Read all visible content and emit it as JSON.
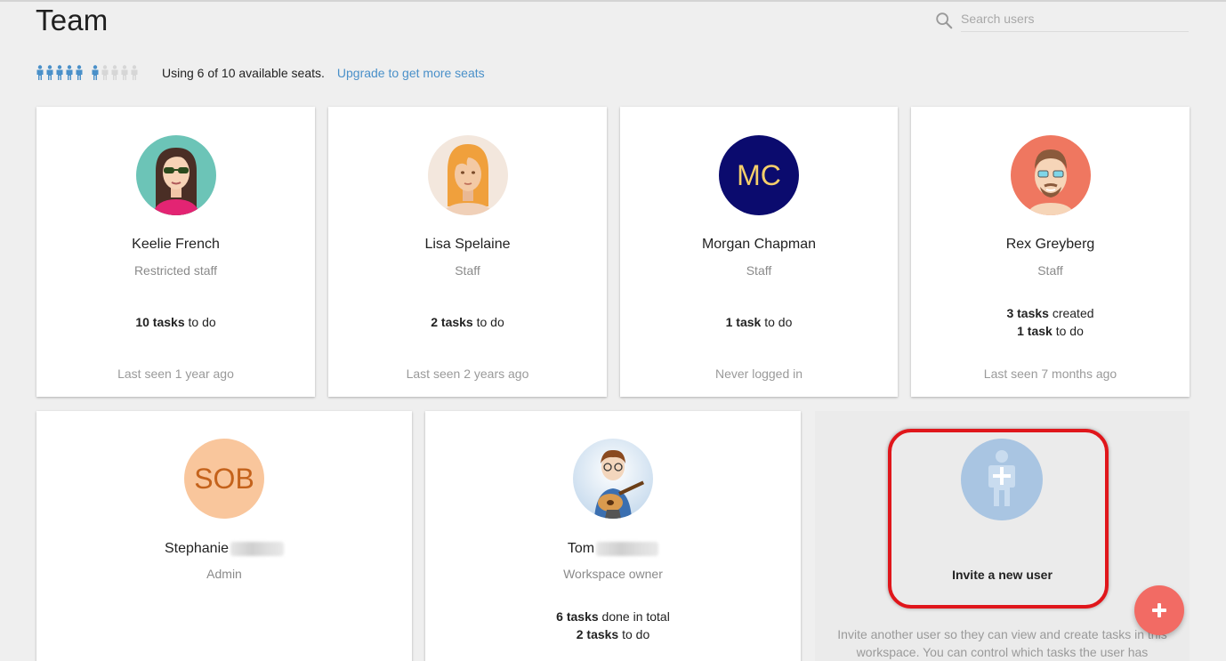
{
  "header": {
    "title": "Team",
    "search_placeholder": "Search users"
  },
  "seats": {
    "used": 6,
    "total": 10,
    "text": "Using 6 of 10 available seats.",
    "upgrade_link": "Upgrade to get more seats",
    "used_color": "#4a90c9",
    "free_color": "#d6d6d6"
  },
  "users": [
    {
      "name": "Keelie French",
      "role": "Restricted staff",
      "tasks": [
        {
          "count": "10 tasks",
          "suffix": " to do"
        }
      ],
      "last_seen": "Last seen 1 year ago",
      "avatar": "illustrated-woman-sunglasses"
    },
    {
      "name": "Lisa Spelaine",
      "role": "Staff",
      "tasks": [
        {
          "count": "2 tasks",
          "suffix": " to do"
        }
      ],
      "last_seen": "Last seen 2 years ago",
      "avatar": "illustrated-woman-blonde"
    },
    {
      "name": "Morgan Chapman",
      "role": "Staff",
      "tasks": [
        {
          "count": "1 task",
          "suffix": " to do"
        }
      ],
      "last_seen": "Never logged in",
      "avatar_initials": "MC",
      "avatar_bg": "#0b0b6e",
      "avatar_fg": "#f5cf6a"
    },
    {
      "name": "Rex Greyberg",
      "role": "Staff",
      "tasks": [
        {
          "count": "3 tasks",
          "suffix": " created"
        },
        {
          "count": "1 task",
          "suffix": " to do"
        }
      ],
      "last_seen": "Last seen 7 months ago",
      "avatar": "illustrated-man-beard"
    },
    {
      "name": "Stephanie",
      "role": "Admin",
      "avatar_initials": "SOB",
      "avatar_bg": "#f9c69c",
      "avatar_fg": "#c4621b"
    },
    {
      "name": "Tom",
      "role": "Workspace owner",
      "tasks": [
        {
          "count": "6 tasks",
          "suffix": " done in total"
        },
        {
          "count": "2 tasks",
          "suffix": " to do"
        }
      ],
      "avatar": "cartoon-guitarist"
    }
  ],
  "invite": {
    "label": "Invite a new user",
    "description": "Invite another user so they can view and create tasks in this workspace. You can control which tasks the user has",
    "highlight_color": "#e0161b"
  },
  "fab": {
    "icon": "plus-icon",
    "color": "#f26b64"
  }
}
